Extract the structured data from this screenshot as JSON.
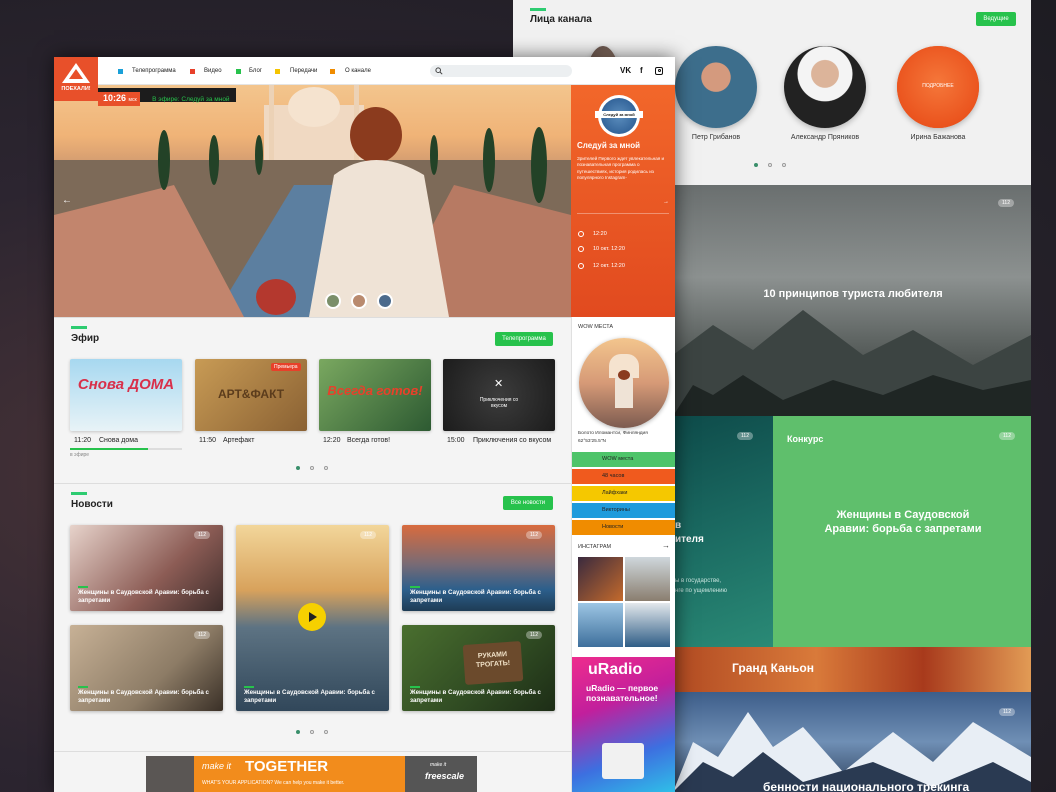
{
  "channel_faces": {
    "title": "Лица канала",
    "button": "Ведущие",
    "hover_label": "ПОДРОБНЕЕ",
    "people": [
      "Петр Грибанов",
      "Александр Пряников",
      "Ирина Бажанова"
    ]
  },
  "back_tiles": {
    "views": "112",
    "tourist": "10 принципов туриста любителя",
    "contest_label": "Конкурс",
    "contest_title": "Женщины в Саудовской Аравии: борьба с запретами",
    "teal_fragment_1": "в",
    "teal_fragment_2": "ителя",
    "teal_small_1": "ы в государстве,",
    "teal_small_2": "нге по ущемлению",
    "canyon": "Гранд Каньон",
    "trekking": "бенности национального трекинга"
  },
  "header": {
    "logo_text": "ПОЕХАЛИ!",
    "nav": [
      "Телепрограмма",
      "Видео",
      "Блог",
      "Передачи",
      "О канале"
    ],
    "nav_colors": [
      "#1aa0d8",
      "#e8402a",
      "#27c24c",
      "#f5c400",
      "#f08c00"
    ],
    "social": [
      "VK",
      "f",
      "IG"
    ]
  },
  "onair": {
    "time": "10:26",
    "tz": "мск",
    "now_label": "В эфире:",
    "now_show": "Следуй за мной"
  },
  "hero_panel": {
    "badge": "Следуй за мной",
    "title": "Следуй за мной",
    "desc": "Зрителей Первого ждет увлекательная и познавательная программа о путешествиях, история родилась из популярного Instagram-",
    "times": [
      "12:20",
      "10 окт. 12:20",
      "12 окт. 12:20"
    ]
  },
  "efir": {
    "title": "Эфир",
    "button": "Телепрограмма",
    "premiere": "Премьера",
    "items": [
      {
        "time": "11:20",
        "name": "Снова дома",
        "art": "Снова ДОМА"
      },
      {
        "time": "11:50",
        "name": "Артефакт",
        "art": "АРТ&ФАКТ"
      },
      {
        "time": "12:20",
        "name": "Всегда готов!",
        "art": "Всегда готов!"
      },
      {
        "time": "15:00",
        "name": "Приключения со вкусом",
        "art": "Приключения со вкусом"
      }
    ],
    "onair_note": "в эфире"
  },
  "news": {
    "title": "Новости",
    "button": "Все новости",
    "views": "112",
    "headline": "Женщины в Саудовской Аравии: борьба с запретами",
    "sign_text": "РУКАМИ ТРОГАТЬ!"
  },
  "wow": {
    "label": "WOW МЕСТА",
    "place": "Болото Иломантси, Финляндия",
    "coords": "62°53'25.5\"N",
    "tags": [
      {
        "name": "WOW места",
        "color": "#4ec46a"
      },
      {
        "name": "48 часов",
        "color": "#f05a1e"
      },
      {
        "name": "Лайфхаки",
        "color": "#f5c800"
      },
      {
        "name": "Викторины",
        "color": "#1e9bdc"
      },
      {
        "name": "Новости",
        "color": "#f08c00"
      }
    ]
  },
  "instagram": {
    "label": "ИНСТАГРАМ"
  },
  "uradio": {
    "logo": "uRadio",
    "text": "uRadio — первое познавательное!"
  },
  "ad": {
    "make_it": "make it",
    "together": "TOGETHER",
    "sub": "WHAT'S YOUR APPLICATION? We can help you make it better.",
    "brand_small": "make it",
    "brand": "freescale"
  }
}
